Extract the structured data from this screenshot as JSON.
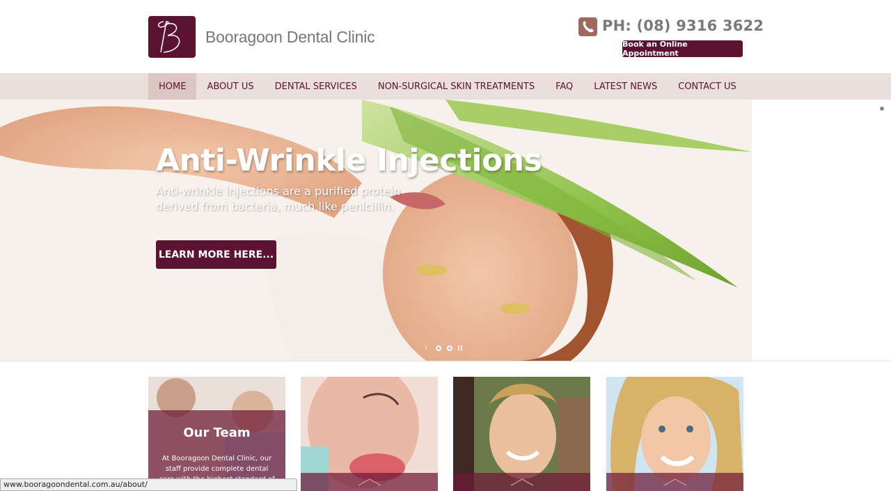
{
  "header": {
    "logo_text": "Booragoon Dental Clinic",
    "phone": "PH: (08) 9316 3622",
    "book_button": "Book an Online Appointment"
  },
  "nav": {
    "items": [
      {
        "label": "HOME",
        "active": true
      },
      {
        "label": "ABOUT US"
      },
      {
        "label": "DENTAL SERVICES"
      },
      {
        "label": "NON-SURGICAL SKIN TREATMENTS"
      },
      {
        "label": "FAQ"
      },
      {
        "label": "LATEST NEWS"
      },
      {
        "label": "CONTACT US"
      }
    ]
  },
  "hero": {
    "title": "Anti-Wrinkle Injections",
    "subtitle": "Anti-wrinkle injections are a purified protein derived from bacteria, much like penicillin.",
    "button": "LEARN MORE HERE..."
  },
  "cards": [
    {
      "title": "Our Team",
      "text": "At Booragoon Dental Clinic, our staff provide complete dental care with the highest standard of"
    },
    {
      "title": ""
    },
    {
      "title": ""
    },
    {
      "title": ""
    }
  ],
  "status_bar": {
    "url": "www.booragoondental.com.au/about/"
  },
  "colors": {
    "brand": "#5c1331",
    "nav_bg": "#ebdfdd",
    "nav_active": "#dcc6c3",
    "phone_icon": "#a0685e"
  },
  "icons": {
    "logo": "logo-b-icon",
    "phone": "phone-icon",
    "chevron": "chevron-up-icon"
  }
}
